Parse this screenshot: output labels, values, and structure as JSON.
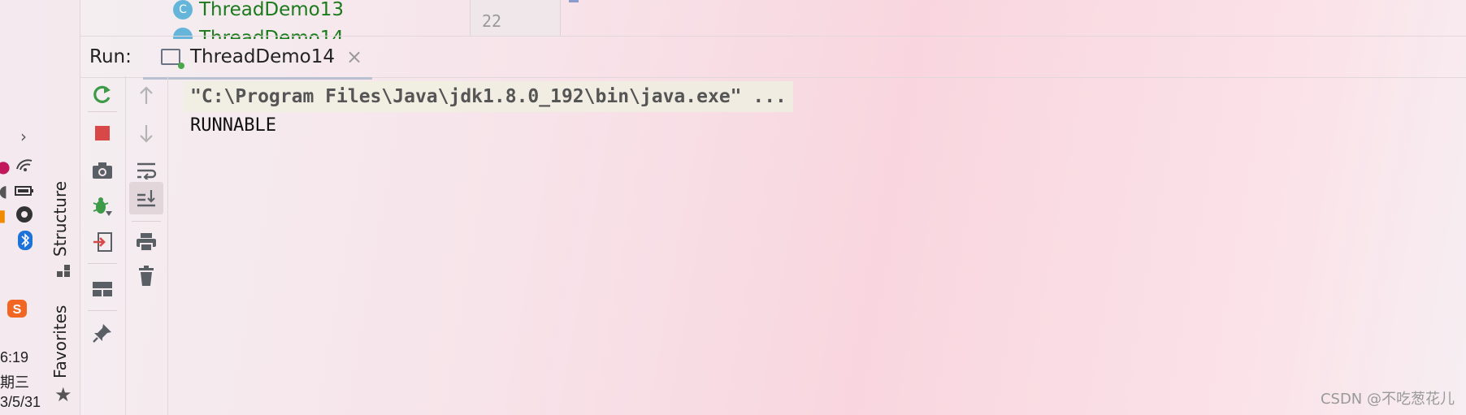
{
  "tray": {
    "time": "6:19",
    "weekday": "期三",
    "date": "3/5/31"
  },
  "stripe": {
    "structure_label": "Structure",
    "favorites_label": "Favorites"
  },
  "tree": {
    "item1": "ThreadDemo13",
    "item2": "ThreadDemo14",
    "line_number": "22",
    "class_icon_letter": "C"
  },
  "run": {
    "label": "Run:",
    "tab_title": "ThreadDemo14",
    "close_glyph": "×"
  },
  "console": {
    "command": "\"C:\\Program Files\\Java\\jdk1.8.0_192\\bin\\java.exe\" ...",
    "output": "RUNNABLE"
  },
  "watermark": "CSDN @不吃葱花儿",
  "colors": {
    "rerun": "#3c9a48",
    "stop": "#d94848",
    "debug": "#3c9a48",
    "tree_text": "#1b7a1b"
  }
}
